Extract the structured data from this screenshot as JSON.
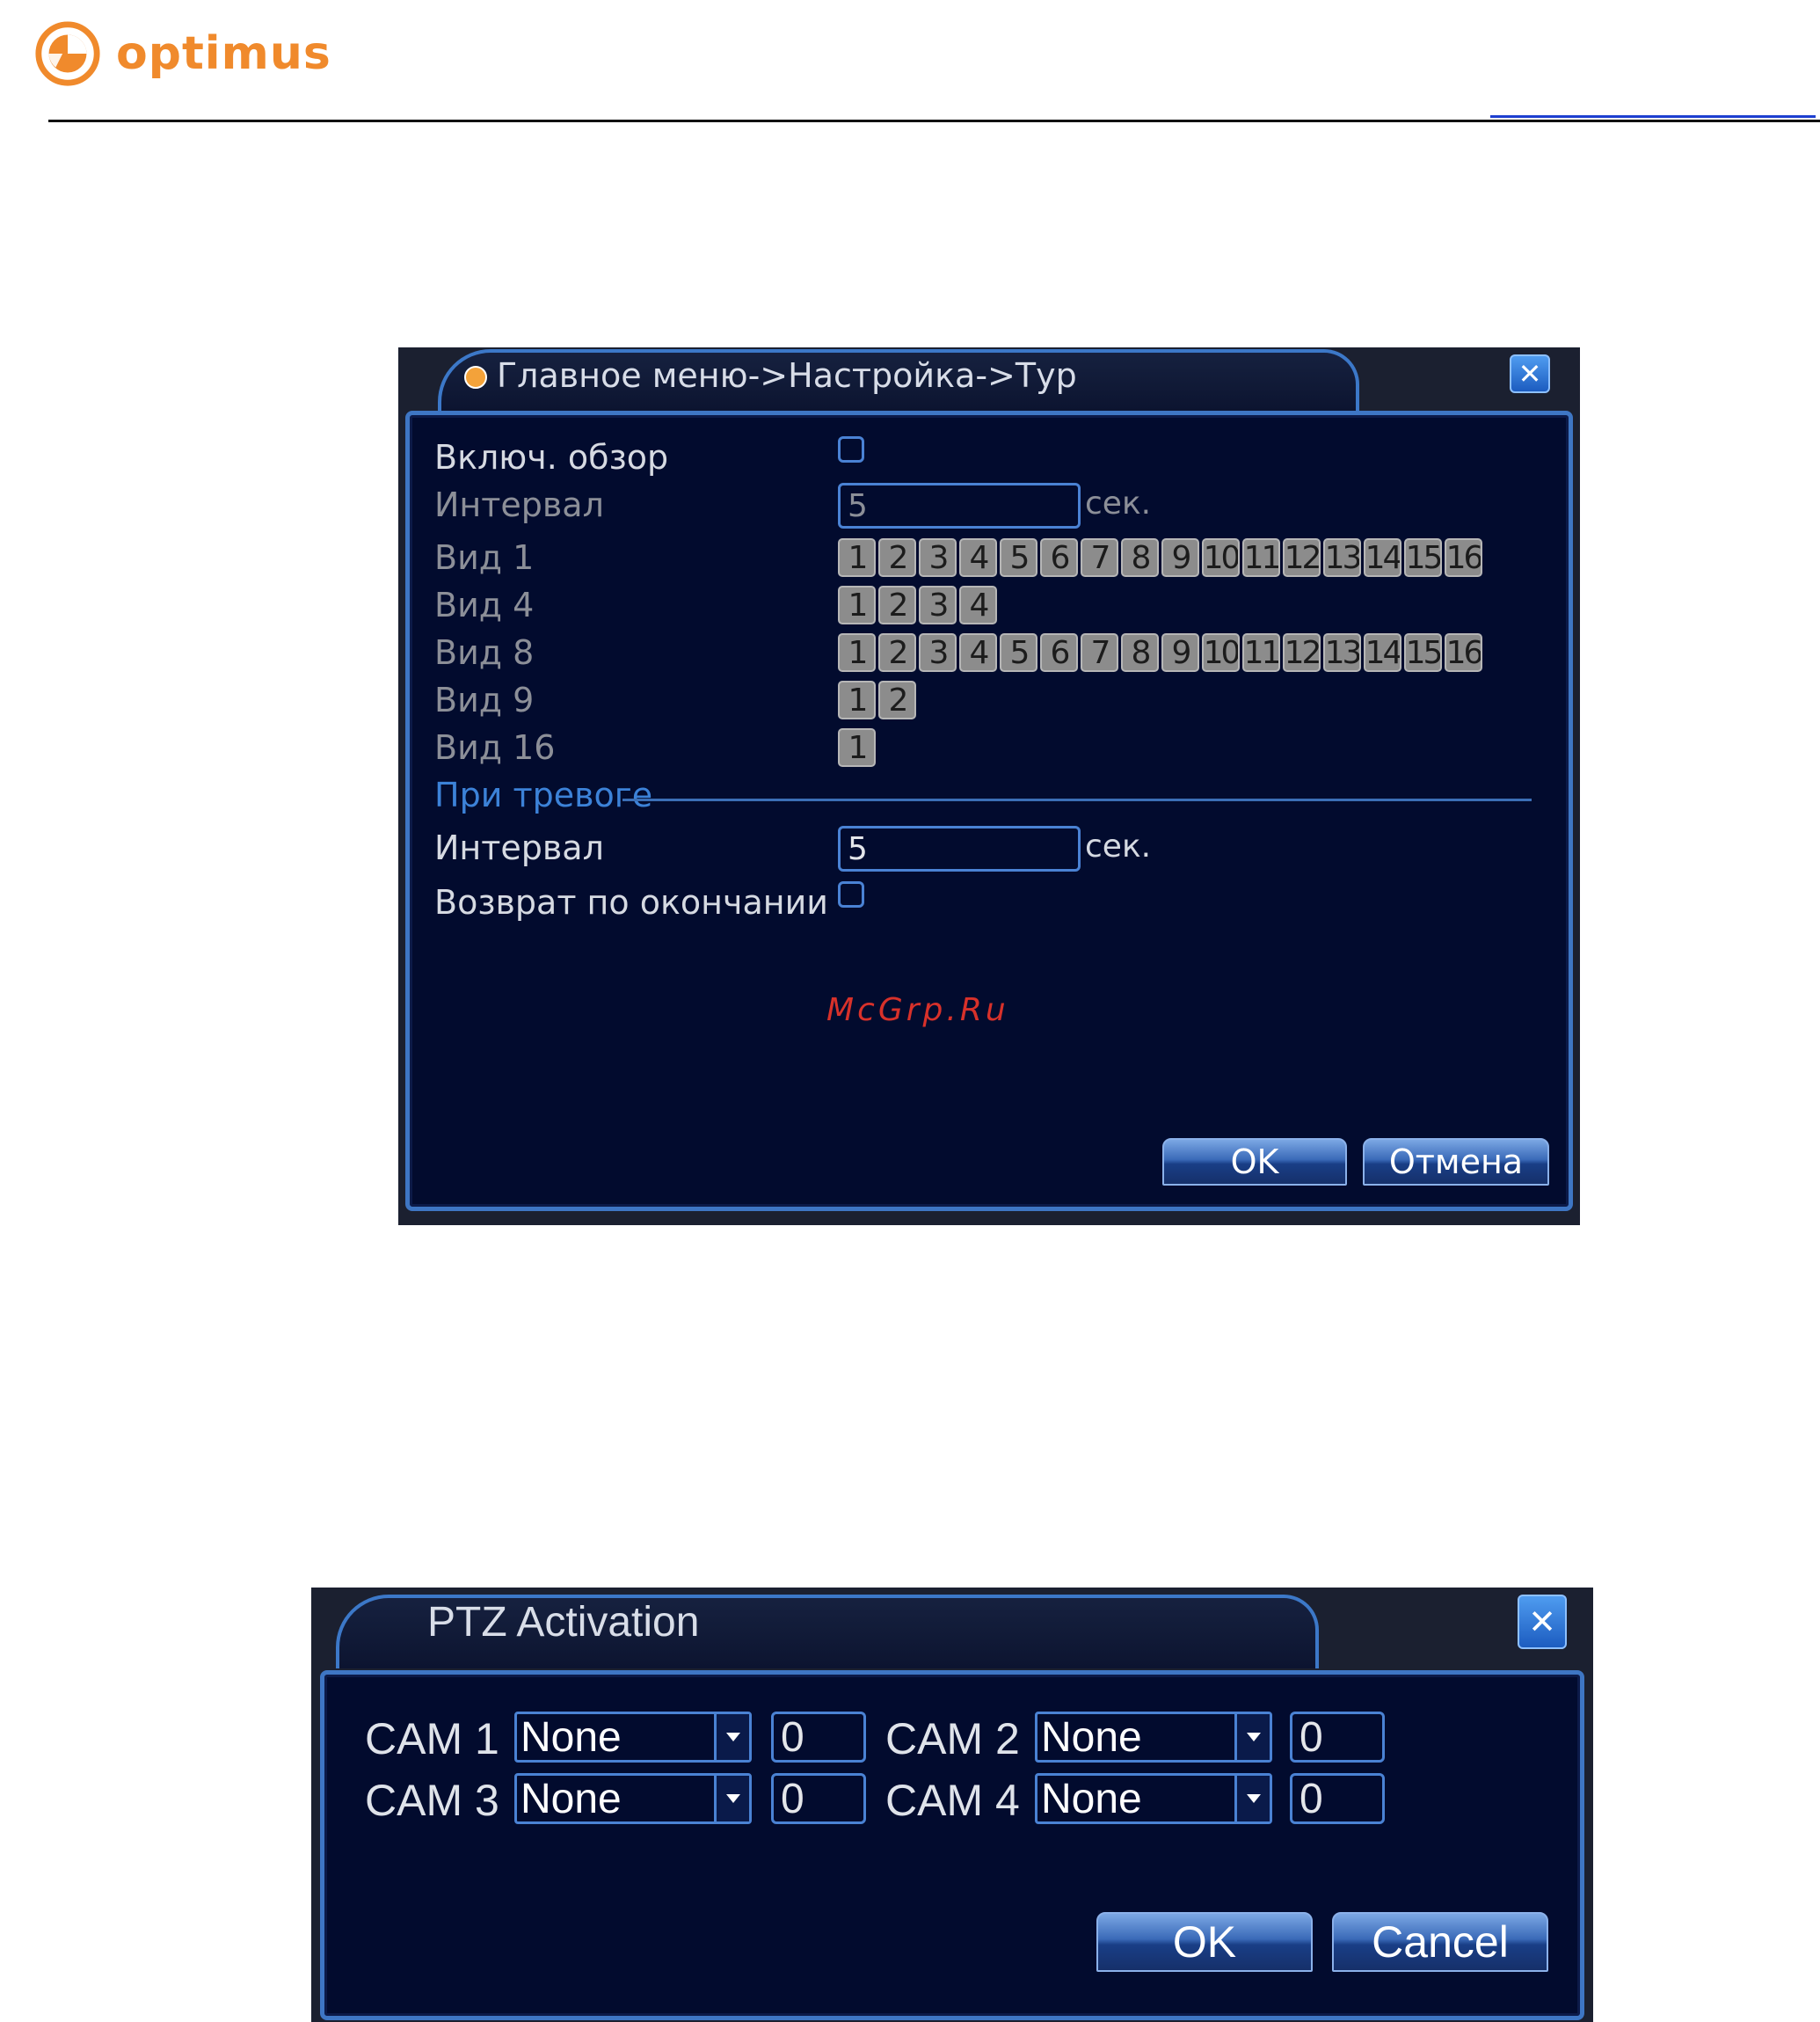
{
  "header": {
    "brand": "optimus",
    "colors": {
      "brand": "#f08a2c",
      "rule": "#111111",
      "link_line": "#1d3fd0"
    }
  },
  "tour_dialog": {
    "title": "Главное меню->Настройка->Тур",
    "close_icon": "close-icon",
    "enable_label": "Включ. обзор",
    "interval_label": "Интервал",
    "interval_value": "5",
    "interval_unit": "сек.",
    "views": [
      {
        "label": "Вид 1",
        "numbers": [
          "1",
          "2",
          "3",
          "4",
          "5",
          "6",
          "7",
          "8",
          "9",
          "10",
          "11",
          "12",
          "13",
          "14",
          "15",
          "16"
        ]
      },
      {
        "label": "Вид 4",
        "numbers": [
          "1",
          "2",
          "3",
          "4"
        ]
      },
      {
        "label": "Вид 8",
        "numbers": [
          "1",
          "2",
          "3",
          "4",
          "5",
          "6",
          "7",
          "8",
          "9",
          "10",
          "11",
          "12",
          "13",
          "14",
          "15",
          "16"
        ]
      },
      {
        "label": "Вид 9",
        "numbers": [
          "1",
          "2"
        ]
      },
      {
        "label": "Вид 16",
        "numbers": [
          "1"
        ]
      }
    ],
    "alarm_section": "При тревоге",
    "alarm_interval_label": "Интервал",
    "alarm_interval_value": "5",
    "alarm_interval_unit": "сек.",
    "return_label": "Возврат по окончании",
    "ok_label": "OK",
    "cancel_label": "Отмена"
  },
  "watermark": "McGrp.Ru",
  "ptz_dialog": {
    "title": "PTZ Activation",
    "close_icon": "close-icon",
    "cams": [
      {
        "label": "CAM 1",
        "select": "None",
        "value": "0"
      },
      {
        "label": "CAM 2",
        "select": "None",
        "value": "0"
      },
      {
        "label": "CAM 3",
        "select": "None",
        "value": "0"
      },
      {
        "label": "CAM 4",
        "select": "None",
        "value": "0"
      }
    ],
    "ok_label": "OK",
    "cancel_label": "Cancel"
  }
}
